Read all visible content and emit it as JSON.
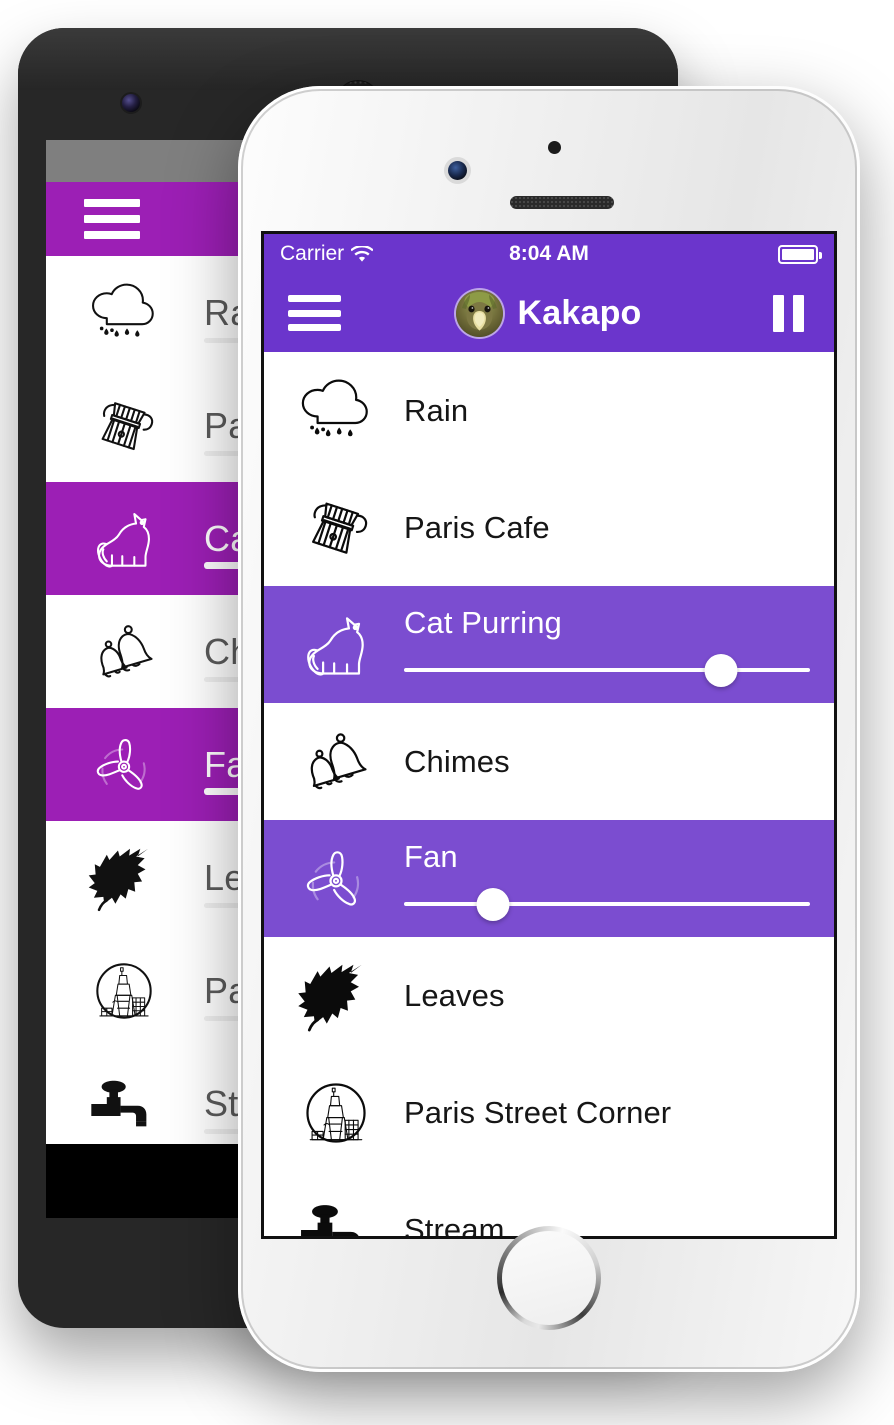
{
  "android": {
    "device_name": "android-phone-back",
    "app_bar": {
      "menu_icon": "hamburger-menu-icon"
    },
    "accent_color": "#9C1FB5",
    "status_bar_color": "#7F7F7F",
    "nav_back_icon": "back-triangle-icon",
    "rows": [
      {
        "label": "Rain",
        "icon": "rain-cloud-icon",
        "selected": false
      },
      {
        "label": "Paris Cafe",
        "icon": "moka-pot-icon",
        "selected": false
      },
      {
        "label": "Cat Purring",
        "icon": "cat-icon",
        "selected": true
      },
      {
        "label": "Chimes",
        "icon": "bells-icon",
        "selected": false
      },
      {
        "label": "Fan",
        "icon": "fan-propeller-icon",
        "selected": true
      },
      {
        "label": "Leaves",
        "icon": "leaf-icon",
        "selected": false
      },
      {
        "label": "Paris Street Corner",
        "icon": "eiffel-tower-circle-icon",
        "selected": false
      },
      {
        "label": "Stream",
        "icon": "faucet-tap-icon",
        "selected": false
      }
    ]
  },
  "iphone": {
    "device_name": "iphone-front",
    "status_bar": {
      "carrier": "Carrier",
      "wifi_icon": "wifi-icon",
      "time": "8:04 AM",
      "battery_icon": "battery-full-icon"
    },
    "nav_bar": {
      "menu_icon": "hamburger-menu-icon",
      "avatar_icon": "kakapo-avatar",
      "title": "Kakapo",
      "pause_icon": "pause-icon"
    },
    "accent_color": "#6B35CC",
    "selected_row_color": "#7B4DD0",
    "rows": [
      {
        "label": "Rain",
        "icon": "rain-cloud-icon",
        "selected": false,
        "slider": null
      },
      {
        "label": "Paris Cafe",
        "icon": "moka-pot-icon",
        "selected": false,
        "slider": null
      },
      {
        "label": "Cat Purring",
        "icon": "cat-icon",
        "selected": true,
        "slider": 78
      },
      {
        "label": "Chimes",
        "icon": "bells-icon",
        "selected": false,
        "slider": null
      },
      {
        "label": "Fan",
        "icon": "fan-propeller-icon",
        "selected": true,
        "slider": 22
      },
      {
        "label": "Leaves",
        "icon": "leaf-icon",
        "selected": false,
        "slider": null
      },
      {
        "label": "Paris Street Corner",
        "icon": "eiffel-tower-circle-icon",
        "selected": false,
        "slider": null
      },
      {
        "label": "Stream",
        "icon": "faucet-tap-icon",
        "selected": false,
        "slider": null
      }
    ]
  }
}
